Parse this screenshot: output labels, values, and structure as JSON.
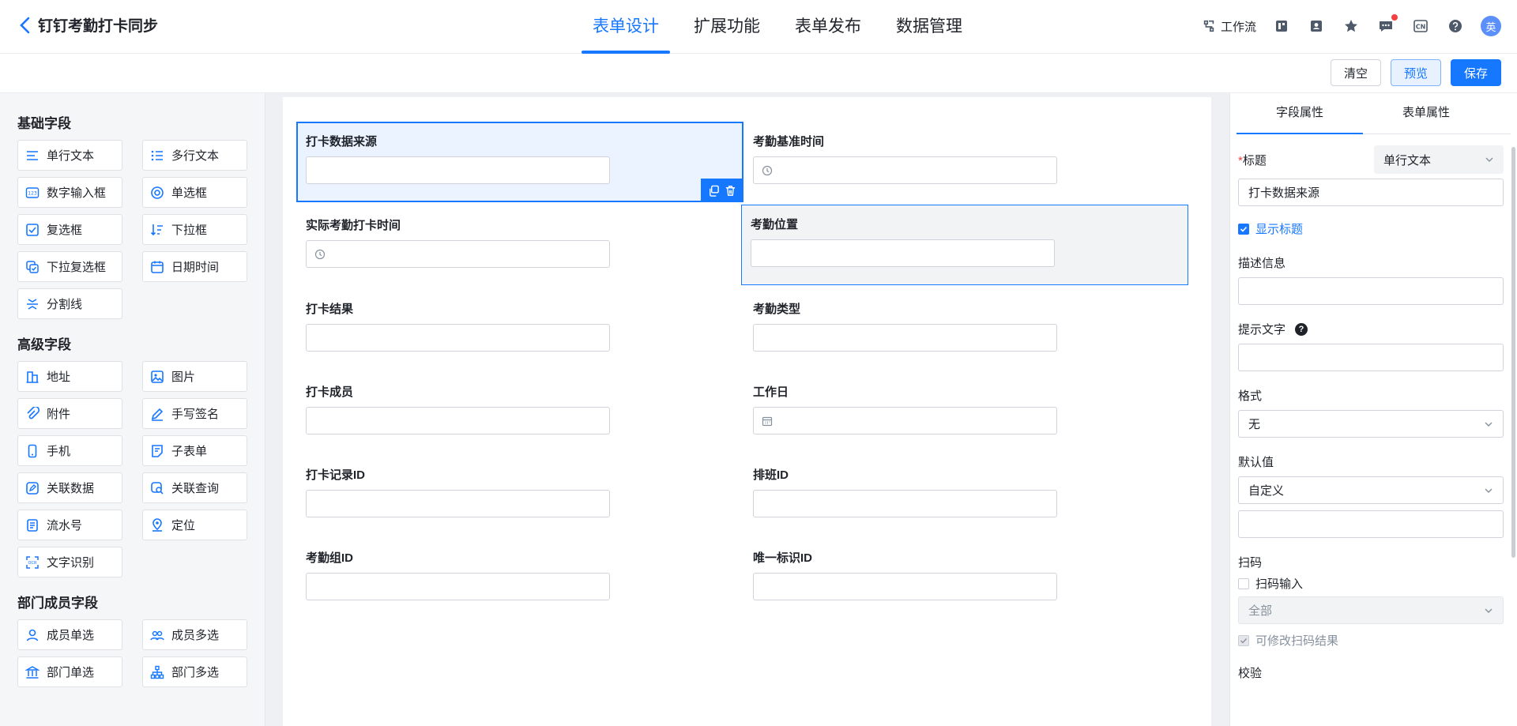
{
  "app": {
    "back_title": "钉钉考勤打卡同步"
  },
  "nav": {
    "tabs": [
      "表单设计",
      "扩展功能",
      "表单发布",
      "数据管理"
    ],
    "active_index": 0
  },
  "header": {
    "workflow_label": "工作流",
    "avatar_text": "英"
  },
  "toolbar": {
    "clear_label": "清空",
    "preview_label": "预览",
    "save_label": "保存"
  },
  "colors": {
    "accent": "#1677ff",
    "selected_bg": "#eaf3ff",
    "badge": "#f53f3f"
  },
  "left_panel": {
    "sections": [
      {
        "title": "基础字段",
        "items": [
          {
            "label": "单行文本",
            "icon": "lines-icon"
          },
          {
            "label": "多行文本",
            "icon": "multiline-icon"
          },
          {
            "label": "数字输入框",
            "icon": "number-icon"
          },
          {
            "label": "单选框",
            "icon": "radio-icon"
          },
          {
            "label": "复选框",
            "icon": "checkbox-icon"
          },
          {
            "label": "下拉框",
            "icon": "sort-down-icon"
          },
          {
            "label": "下拉复选框",
            "icon": "multi-select-icon"
          },
          {
            "label": "日期时间",
            "icon": "calendar-icon"
          },
          {
            "label": "分割线",
            "icon": "divider-icon"
          }
        ]
      },
      {
        "title": "高级字段",
        "items": [
          {
            "label": "地址",
            "icon": "building-icon"
          },
          {
            "label": "图片",
            "icon": "image-icon"
          },
          {
            "label": "附件",
            "icon": "paperclip-icon"
          },
          {
            "label": "手写签名",
            "icon": "pen-icon"
          },
          {
            "label": "手机",
            "icon": "phone-icon"
          },
          {
            "label": "子表单",
            "icon": "subform-icon"
          },
          {
            "label": "关联数据",
            "icon": "edit-link-icon"
          },
          {
            "label": "关联查询",
            "icon": "search-link-icon"
          },
          {
            "label": "流水号",
            "icon": "serial-icon"
          },
          {
            "label": "定位",
            "icon": "location-icon"
          },
          {
            "label": "文字识别",
            "icon": "ocr-icon"
          }
        ]
      },
      {
        "title": "部门成员字段",
        "items": [
          {
            "label": "成员单选",
            "icon": "user-icon"
          },
          {
            "label": "成员多选",
            "icon": "users-icon"
          },
          {
            "label": "部门单选",
            "icon": "department-icon"
          },
          {
            "label": "部门多选",
            "icon": "org-tree-icon"
          }
        ]
      }
    ]
  },
  "form": {
    "fields": [
      {
        "label": "打卡数据来源",
        "input": "text",
        "state": "selected"
      },
      {
        "label": "考勤基准时间",
        "input": "time",
        "state": ""
      },
      {
        "label": "实际考勤打卡时间",
        "input": "time",
        "state": ""
      },
      {
        "label": "考勤位置",
        "input": "text",
        "state": "hovered"
      },
      {
        "label": "打卡结果",
        "input": "text",
        "state": ""
      },
      {
        "label": "考勤类型",
        "input": "text",
        "state": ""
      },
      {
        "label": "打卡成员",
        "input": "text",
        "state": ""
      },
      {
        "label": "工作日",
        "input": "date",
        "state": ""
      },
      {
        "label": "打卡记录ID",
        "input": "text",
        "state": ""
      },
      {
        "label": "排班ID",
        "input": "text",
        "state": ""
      },
      {
        "label": "考勤组ID",
        "input": "text",
        "state": ""
      },
      {
        "label": "唯一标识ID",
        "input": "text",
        "state": ""
      }
    ]
  },
  "right_panel": {
    "tabs": [
      "字段属性",
      "表单属性"
    ],
    "title_label": "标题",
    "required_mark": "*",
    "field_type": "单行文本",
    "title_value": "打卡数据来源",
    "show_title_label": "显示标题",
    "show_title_checked": true,
    "description_label": "描述信息",
    "description_value": "",
    "hint_label": "提示文字",
    "hint_value": "",
    "help_glyph": "?",
    "format_label": "格式",
    "format_value": "无",
    "default_label": "默认值",
    "default_value": "自定义",
    "default_custom_value": "",
    "scan_label": "扫码",
    "scan_input_label": "扫码输入",
    "scan_input_checked": false,
    "scan_scope_value": "全部",
    "scan_modify_label": "可修改扫码结果",
    "validate_label": "校验"
  }
}
